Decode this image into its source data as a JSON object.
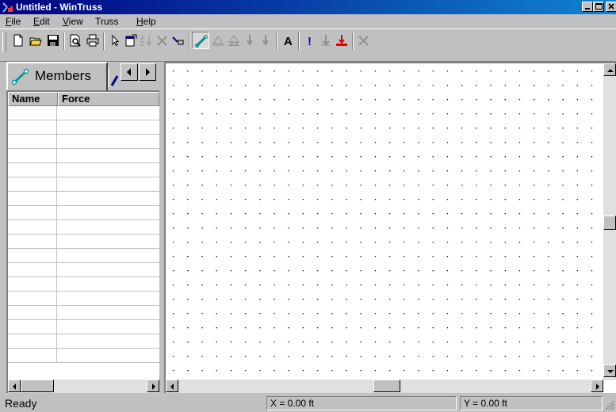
{
  "window": {
    "title": "Untitled - WinTruss",
    "colors": {
      "titlebar_start": "#000080",
      "titlebar_end": "#1084d0",
      "face": "#c0c0c0"
    }
  },
  "menu": {
    "items": [
      {
        "label": "File",
        "accel": "F",
        "rest": "ile"
      },
      {
        "label": "Edit",
        "accel": "E",
        "rest": "dit"
      },
      {
        "label": "View",
        "accel": "V",
        "rest": "iew"
      },
      {
        "label": "Truss",
        "accel": "",
        "rest": "Truss"
      },
      {
        "label": "Help",
        "accel": "H",
        "rest": "elp"
      }
    ]
  },
  "toolbar": {
    "buttons": [
      {
        "name": "new-document-icon"
      },
      {
        "name": "open-folder-icon"
      },
      {
        "name": "save-disk-icon"
      },
      {
        "name": "print-preview-icon"
      },
      {
        "name": "print-icon"
      },
      {
        "name": "select-arrow-icon"
      },
      {
        "name": "properties-icon"
      },
      {
        "name": "sort-icon",
        "disabled": true
      },
      {
        "name": "delete-x-icon",
        "disabled": true
      },
      {
        "name": "move-point-icon"
      },
      {
        "name": "member-tool-icon",
        "pressed": true
      },
      {
        "name": "pin-support-icon",
        "disabled": true
      },
      {
        "name": "roller-support-icon",
        "disabled": true
      },
      {
        "name": "load-down-icon",
        "disabled": true
      },
      {
        "name": "load-down-alt-icon",
        "disabled": true
      },
      {
        "name": "text-label-icon",
        "text": "A"
      },
      {
        "name": "exclamation-icon",
        "text": "!"
      },
      {
        "name": "anchor-icon",
        "disabled": true
      },
      {
        "name": "distributed-load-icon"
      },
      {
        "name": "close-x-icon",
        "disabled": true
      }
    ]
  },
  "left_pane": {
    "tab_label": "Members",
    "columns": [
      "Name",
      "Force"
    ],
    "rows": 18
  },
  "status": {
    "ready": "Ready",
    "x": "X = 0.00 ft",
    "y": "Y = 0.00 ft"
  }
}
